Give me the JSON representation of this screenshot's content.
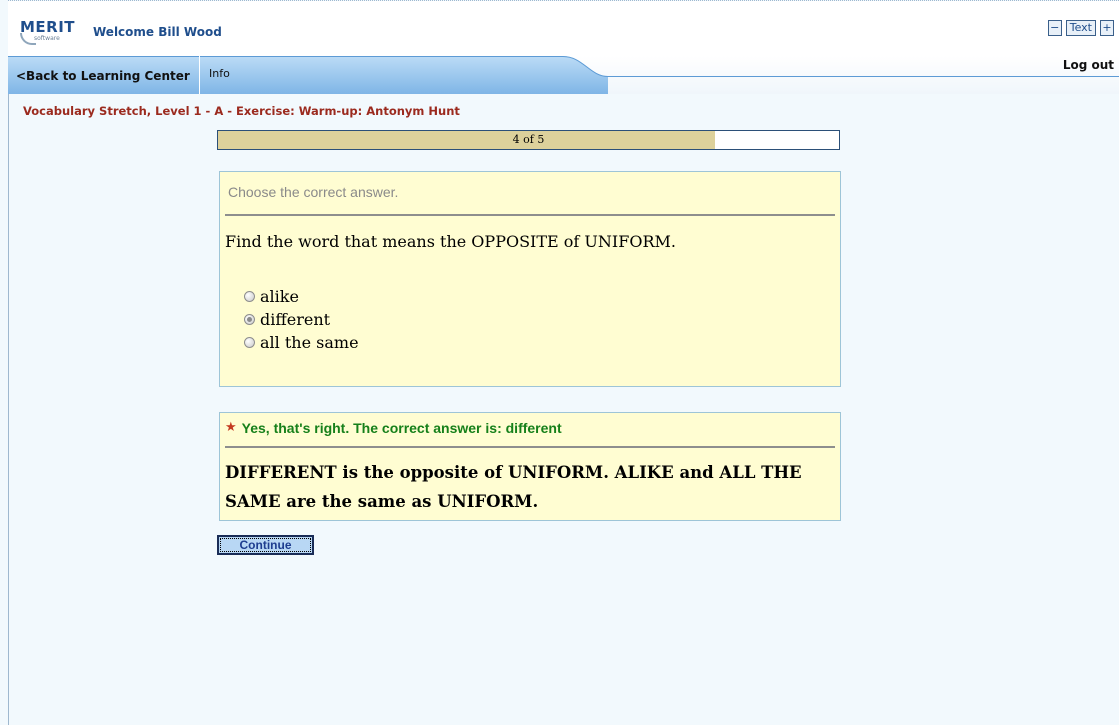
{
  "header": {
    "logo_text": "MERIT",
    "logo_sub": "software",
    "welcome": "Welcome Bill Wood",
    "text_minus": "−",
    "text_label": "Text",
    "text_plus": "+"
  },
  "nav": {
    "back_label": "<Back to Learning Center",
    "info_label": "Info",
    "logout_label": "Log out"
  },
  "breadcrumb": "Vocabulary Stretch, Level 1 - A - Exercise: Warm-up: Antonym Hunt",
  "progress": {
    "label": "4 of 5",
    "fraction": 0.8
  },
  "question": {
    "instruction": "Choose the correct answer.",
    "prompt": "Find the word that means the OPPOSITE of UNIFORM.",
    "options": [
      {
        "label": "alike",
        "selected": false
      },
      {
        "label": "different",
        "selected": true
      },
      {
        "label": "all the same",
        "selected": false
      }
    ]
  },
  "feedback": {
    "status": "Yes, that's right. The correct answer is: different",
    "explanation": "DIFFERENT is the opposite of UNIFORM. ALIKE and ALL THE SAME are the same as UNIFORM."
  },
  "continue_label": "Continue",
  "colors": {
    "brand_blue": "#1f4e8c",
    "breadcrumb_red": "#9b2a1e",
    "correct_green": "#16801a",
    "panel_yellow": "#fffdd2",
    "progress_fill": "#ddd19b"
  }
}
